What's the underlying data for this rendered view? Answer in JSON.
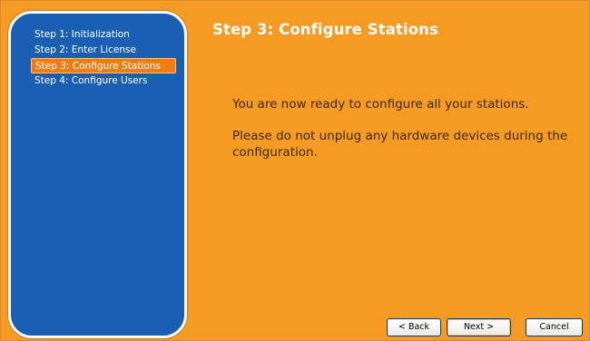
{
  "wizard": {
    "steps": [
      {
        "label": "Step 1: Initialization",
        "active": false
      },
      {
        "label": "Step 2: Enter License",
        "active": false
      },
      {
        "label": "Step 3: Configure Stations",
        "active": true
      },
      {
        "label": "Step 4: Configure Users",
        "active": false
      }
    ],
    "title": "Step 3: Configure Stations",
    "message_1": "You are now ready to configure all your stations.",
    "message_2": "Please do not unplug any hardware devices during the configuration.",
    "buttons": {
      "back": "< Back",
      "next": "Next >",
      "cancel": "Cancel"
    }
  },
  "colors": {
    "background": "#f59a23",
    "sidebar": "#1a5fb4",
    "active_step": "#f07c16"
  }
}
